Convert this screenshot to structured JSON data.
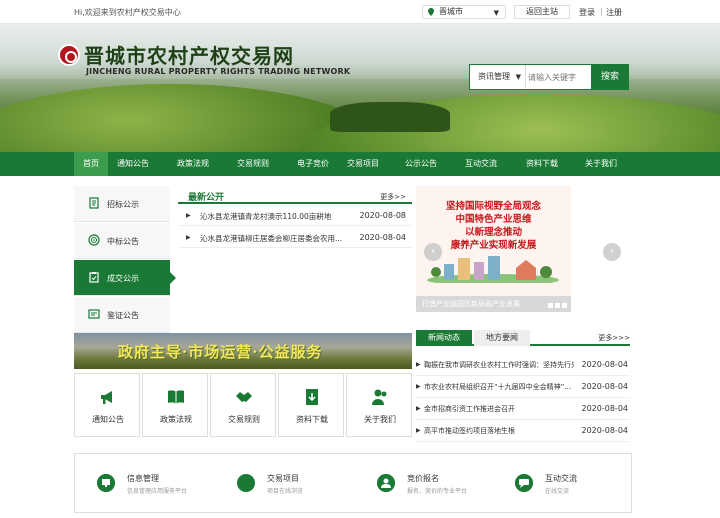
{
  "topbar": {
    "welcome": "Hi,欢迎来到农村产权交易中心",
    "city": "晋城市",
    "main_site": "返回主站",
    "login": "登录",
    "sep": "|",
    "register": "注册"
  },
  "logo": {
    "cn": "晋城市农村产权交易网",
    "en": "JINCHENG RURAL PROPERTY RIGHTS TRADING NETWORK"
  },
  "search": {
    "category": "资讯管理",
    "placeholder": "请输入关键字",
    "button": "搜索"
  },
  "nav": [
    "首页",
    "通知公告",
    "政策法规",
    "交易规则",
    "电子竞价",
    "交易项目",
    "公示公告",
    "互动交流",
    "资料下载",
    "关于我们"
  ],
  "side": [
    {
      "label": "招标公示",
      "icon": "document-icon"
    },
    {
      "label": "中标公告",
      "icon": "target-icon"
    },
    {
      "label": "成交公示",
      "icon": "clipboard-icon"
    },
    {
      "label": "鉴证公告",
      "icon": "certificate-icon"
    }
  ],
  "latest": {
    "title": "最新公开",
    "more": "更多>>",
    "items": [
      {
        "text": "沁水县龙港镇青龙村澳示110.00亩耕地",
        "date": "2020-08-08"
      },
      {
        "text": "沁水县龙港镇柳庄居委会柳庄居委会农用...",
        "date": "2020-08-04"
      }
    ]
  },
  "slide": {
    "lines": [
      "坚持国际视野全局观念",
      "中国特色产业思维",
      "以新理念推动",
      "康养产业实现新发展"
    ],
    "caption": "打造产业链园区新局面产业发展"
  },
  "slogan": "政府主导·市场运营·公益服务",
  "quick": [
    {
      "label": "通知公告",
      "icon": "megaphone-icon"
    },
    {
      "label": "政策法规",
      "icon": "book-icon"
    },
    {
      "label": "交易规则",
      "icon": "handshake-icon"
    },
    {
      "label": "资料下载",
      "icon": "download-icon"
    },
    {
      "label": "关于我们",
      "icon": "people-icon"
    }
  ],
  "news": {
    "tab1": "新闻动态",
    "tab2": "地方要闻",
    "more": "更多>>>",
    "items": [
      {
        "text": "鞠振在我市调研农业农村工作时强调：坚持先行先...",
        "date": "2020-08-04"
      },
      {
        "text": "市农业农村局组织召开“十九届四中全会精神”...",
        "date": "2020-08-04"
      },
      {
        "text": "金市招商引资工作推进会召开",
        "date": "2020-08-04"
      },
      {
        "text": "高平市推动签约项目落地生根",
        "date": "2020-08-04"
      }
    ]
  },
  "services": [
    {
      "title": "信息管理",
      "sub": "信息管理应用服务平台",
      "icon": "monitor-icon"
    },
    {
      "title": "交易项目",
      "sub": "项目在线浏览",
      "icon": "handshake-icon"
    },
    {
      "title": "竞价报名",
      "sub": "报名、竞价的专业平台",
      "icon": "bid-icon"
    },
    {
      "title": "互动交流",
      "sub": "在线交流",
      "icon": "chat-icon"
    }
  ]
}
